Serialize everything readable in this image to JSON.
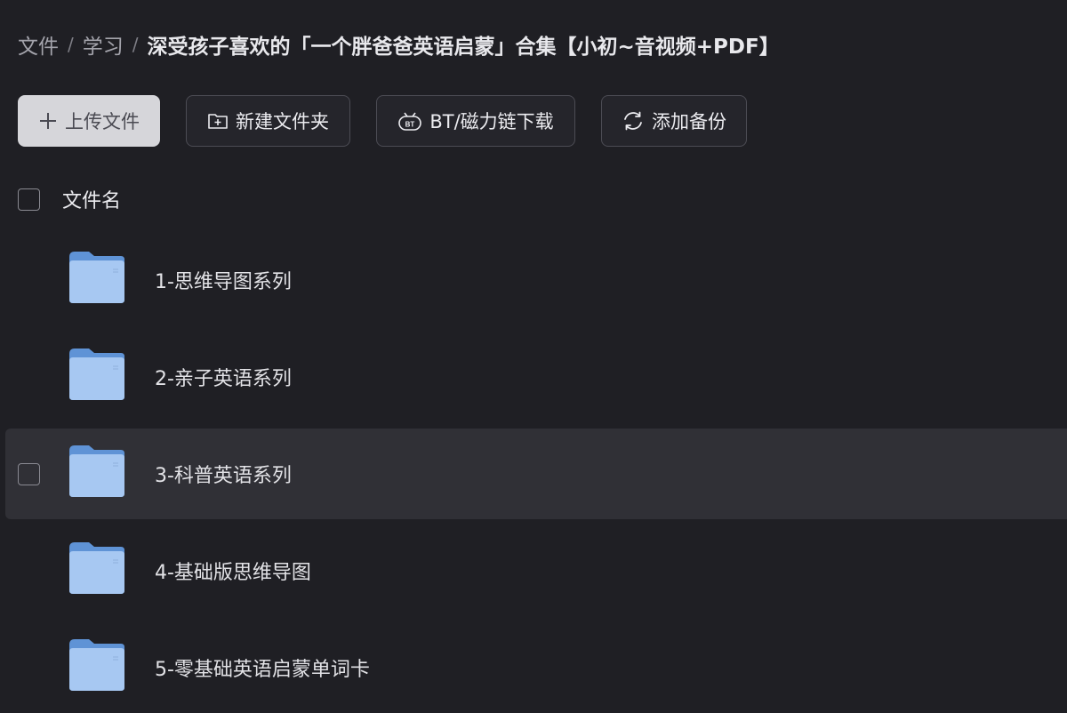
{
  "breadcrumb": {
    "items": [
      "文件",
      "学习",
      "深受孩子喜欢的「一个胖爸爸英语启蒙」合集【小初~音视频+PDF】"
    ],
    "separator": "/"
  },
  "toolbar": {
    "upload_label": "上传文件",
    "new_folder_label": "新建文件夹",
    "bt_label": "BT/磁力链下载",
    "backup_label": "添加备份"
  },
  "list": {
    "header": "文件名",
    "items": [
      {
        "name": "1-思维导图系列",
        "icon": "folder-icon"
      },
      {
        "name": "2-亲子英语系列",
        "icon": "folder-icon"
      },
      {
        "name": "3-科普英语系列",
        "icon": "folder-icon"
      },
      {
        "name": "4-基础版思维导图",
        "icon": "folder-icon"
      },
      {
        "name": "5-零基础英语启蒙单词卡",
        "icon": "folder-icon"
      }
    ]
  },
  "colors": {
    "background": "#1f1f24",
    "hover_row": "#303036",
    "primary_button": "#d6d6da",
    "folder_blue": "#8fb7ea"
  }
}
